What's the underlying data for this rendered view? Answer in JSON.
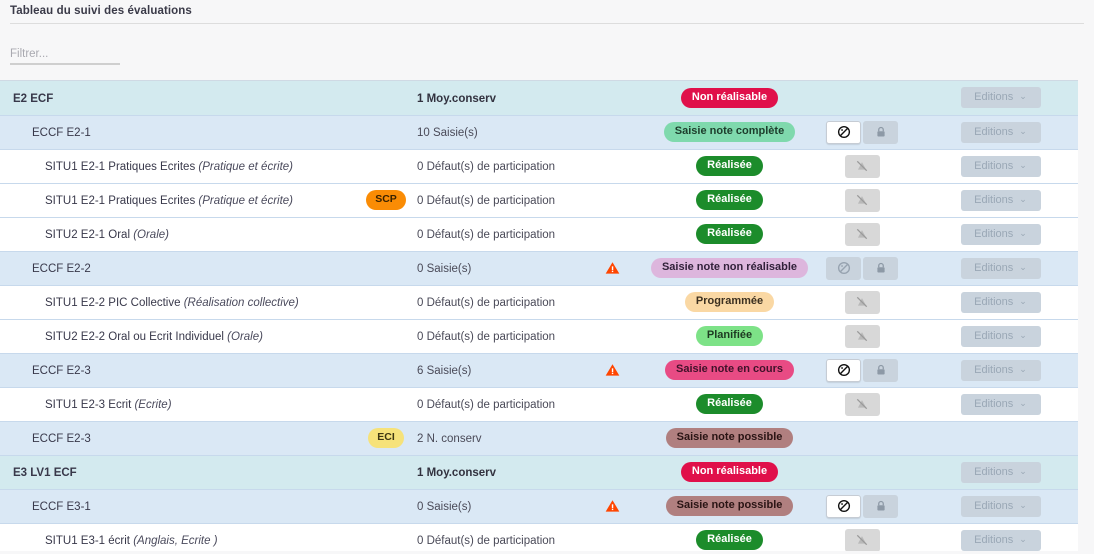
{
  "header": {
    "title": "Tableau du suivi des évaluations"
  },
  "filter": {
    "placeholder": "Filtrer...",
    "value": ""
  },
  "buttons": {
    "editions_label": "Editions",
    "chevron": "⌄"
  },
  "icons": {
    "no_entry": "no-entry-icon",
    "lock": "lock-icon",
    "muted": "crossed-out-icon",
    "warning": "warning-triangle-icon"
  },
  "colors": {
    "row_level0": "#d3eaef",
    "row_level1": "#dae8f5",
    "row_level2": "#ffffff",
    "badge_non_realisable_bg": "#e0104a",
    "badge_non_realisable_fg": "#ffffff",
    "badge_saisie_complete_bg": "#7fd9ad",
    "badge_saisie_complete_fg": "#1d3d2c",
    "badge_realisee_bg": "#1c8c2b",
    "badge_realisee_fg": "#ffffff",
    "badge_non_realisable_saisie_bg": "#ddb6dd",
    "badge_non_realisable_saisie_fg": "#31213a",
    "badge_programmee_bg": "#fad8a4",
    "badge_programmee_fg": "#3c3020",
    "badge_planifiee_bg": "#7de287",
    "badge_planifiee_fg": "#1e3a22",
    "badge_en_cours_bg": "#e84b84",
    "badge_en_cours_fg": "#40122a",
    "badge_possible_bg": "#b07f7f",
    "badge_possible_fg": "#2a1414",
    "tag_scp_bg": "#fa8c05",
    "tag_scp_fg": "#3a2200",
    "tag_eci_bg": "#f6e27a",
    "tag_eci_fg": "#3e3712",
    "warning": "#ff4500"
  },
  "rows": [
    {
      "level": 0,
      "label": "E2 ECF",
      "label_italic": "",
      "tag": "",
      "tag_style": "",
      "info": "1 Moy.conserv",
      "info_bold": true,
      "warning": false,
      "status": "Non réalisable",
      "status_style": "non-realisable",
      "actions": "none",
      "editions": true
    },
    {
      "level": 1,
      "label": "ECCF E2-1",
      "label_italic": "",
      "tag": "",
      "tag_style": "",
      "info": "10 Saisie(s)",
      "info_bold": false,
      "warning": false,
      "status": "Saisie note complète",
      "status_style": "saisie-complete",
      "actions": "entry-lock-active",
      "editions": true
    },
    {
      "level": 2,
      "label": "SITU1 E2-1 Pratiques Ecrites",
      "label_italic": "(Pratique et écrite)",
      "tag": "",
      "tag_style": "",
      "info": "0 Défaut(s) de participation",
      "info_bold": false,
      "warning": false,
      "status": "Réalisée",
      "status_style": "realisee",
      "actions": "muted",
      "editions": true
    },
    {
      "level": 2,
      "label": "SITU1 E2-1 Pratiques Ecrites",
      "label_italic": "(Pratique et écrite)",
      "tag": "SCP",
      "tag_style": "scp",
      "info": "0 Défaut(s) de participation",
      "info_bold": false,
      "warning": false,
      "status": "Réalisée",
      "status_style": "realisee",
      "actions": "muted",
      "editions": true
    },
    {
      "level": 2,
      "label": "SITU2 E2-1 Oral",
      "label_italic": "(Orale)",
      "tag": "",
      "tag_style": "",
      "info": "0 Défaut(s) de participation",
      "info_bold": false,
      "warning": false,
      "status": "Réalisée",
      "status_style": "realisee",
      "actions": "muted",
      "editions": true
    },
    {
      "level": 1,
      "label": "ECCF E2-2",
      "label_italic": "",
      "tag": "",
      "tag_style": "",
      "info": "0 Saisie(s)",
      "info_bold": false,
      "warning": true,
      "status": "Saisie note non réalisable",
      "status_style": "saisie-non-realisable",
      "actions": "entry-lock-disabled",
      "editions": true
    },
    {
      "level": 2,
      "label": "SITU1 E2-2 PIC Collective",
      "label_italic": "(Réalisation collective)",
      "tag": "",
      "tag_style": "",
      "info": "0 Défaut(s) de participation",
      "info_bold": false,
      "warning": false,
      "status": "Programmée",
      "status_style": "programmee",
      "actions": "muted",
      "editions": true
    },
    {
      "level": 2,
      "label": "SITU2 E2-2 Oral ou Ecrit Individuel",
      "label_italic": "(Orale)",
      "tag": "",
      "tag_style": "",
      "info": "0 Défaut(s) de participation",
      "info_bold": false,
      "warning": false,
      "status": "Planifiée",
      "status_style": "planifiee",
      "actions": "muted",
      "editions": true
    },
    {
      "level": 1,
      "label": "ECCF E2-3",
      "label_italic": "",
      "tag": "",
      "tag_style": "",
      "info": "6 Saisie(s)",
      "info_bold": false,
      "warning": true,
      "status": "Saisie note en cours",
      "status_style": "en-cours",
      "actions": "entry-lock-active",
      "editions": true
    },
    {
      "level": 2,
      "label": "SITU1 E2-3 Ecrit",
      "label_italic": "(Ecrite)",
      "tag": "",
      "tag_style": "",
      "info": "0 Défaut(s) de participation",
      "info_bold": false,
      "warning": false,
      "status": "Réalisée",
      "status_style": "realisee",
      "actions": "muted",
      "editions": true
    },
    {
      "level": 1,
      "label": "ECCF E2-3",
      "label_italic": "",
      "tag": "ECI",
      "tag_style": "eci",
      "info": "2 N. conserv",
      "info_bold": false,
      "warning": false,
      "status": "Saisie note possible",
      "status_style": "possible",
      "actions": "none",
      "editions": false
    },
    {
      "level": 0,
      "label": "E3 LV1 ECF",
      "label_italic": "",
      "tag": "",
      "tag_style": "",
      "info": "1 Moy.conserv",
      "info_bold": true,
      "warning": false,
      "status": "Non réalisable",
      "status_style": "non-realisable",
      "actions": "none",
      "editions": true
    },
    {
      "level": 1,
      "label": "ECCF E3-1",
      "label_italic": "",
      "tag": "",
      "tag_style": "",
      "info": "0 Saisie(s)",
      "info_bold": false,
      "warning": true,
      "status": "Saisie note possible",
      "status_style": "possible",
      "actions": "entry-lock-active",
      "editions": true
    },
    {
      "level": 2,
      "label": "SITU1 E3-1 écrit",
      "label_italic": "(Anglais, Ecrite )",
      "tag": "",
      "tag_style": "",
      "info": "0 Défaut(s) de participation",
      "info_bold": false,
      "warning": false,
      "status": "Réalisée",
      "status_style": "realisee",
      "actions": "muted",
      "editions": true
    }
  ]
}
